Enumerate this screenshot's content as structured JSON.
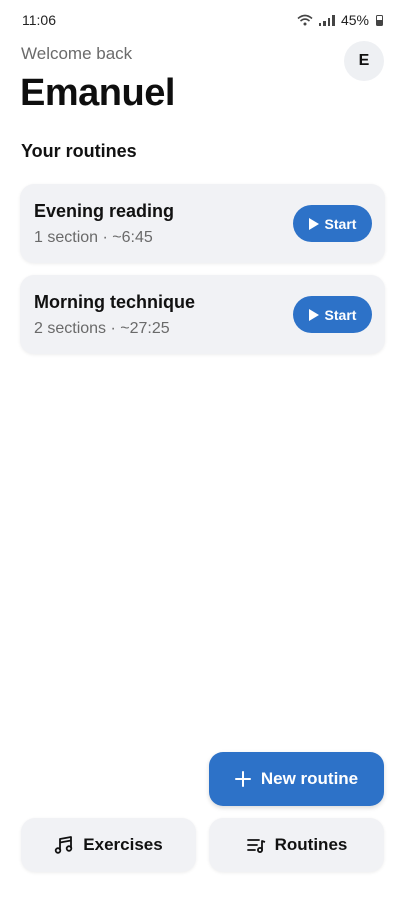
{
  "status_bar": {
    "time": "11:06",
    "battery": "45%"
  },
  "header": {
    "welcome": "Welcome back",
    "username": "Emanuel",
    "avatar_initial": "E"
  },
  "routines_section": {
    "title": "Your routines",
    "items": [
      {
        "name": "Evening reading",
        "meta": "1 section · ~6:45",
        "start_label": "Start"
      },
      {
        "name": "Morning technique",
        "meta": "2 sections · ~27:25",
        "start_label": "Start"
      }
    ]
  },
  "actions": {
    "new_routine_label": "New routine",
    "exercises_label": "Exercises",
    "routines_label": "Routines"
  },
  "colors": {
    "accent": "#2d72c8",
    "card_bg": "#f1f2f5"
  },
  "icons": [
    "wifi-icon",
    "signal-icon",
    "battery-icon",
    "play-icon",
    "plus-icon",
    "music-notes-icon",
    "playlist-icon"
  ]
}
